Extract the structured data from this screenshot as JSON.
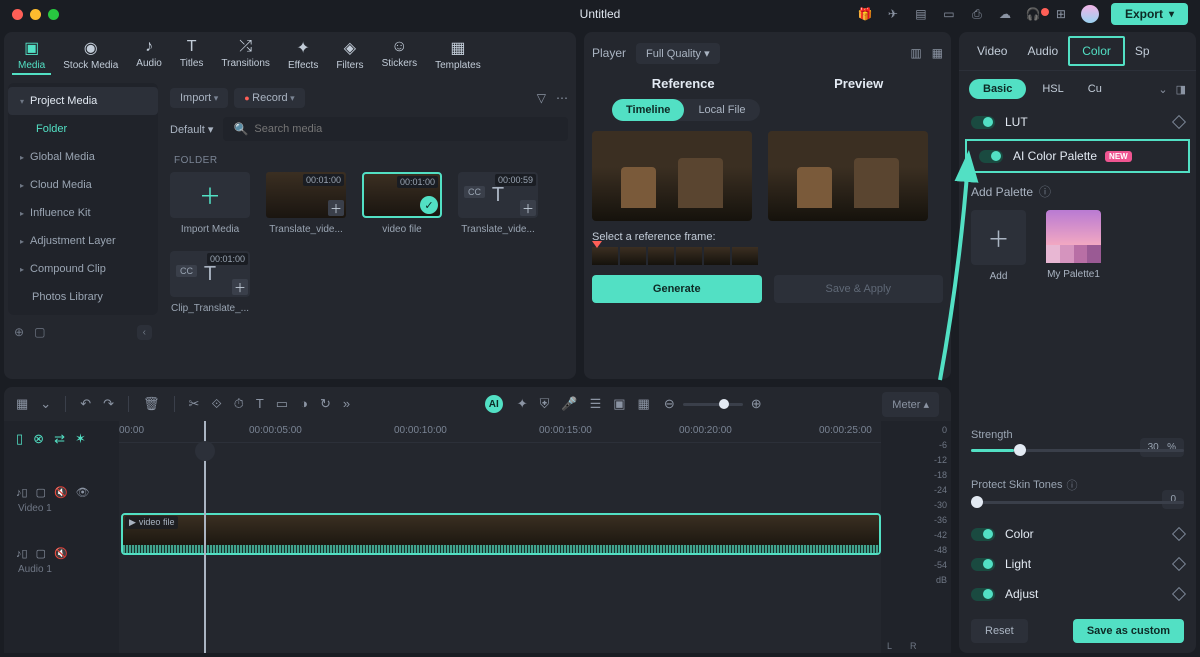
{
  "window": {
    "title": "Untitled"
  },
  "titlebar": {
    "export": "Export"
  },
  "mediaTabs": [
    {
      "id": "media",
      "label": "Media",
      "active": true
    },
    {
      "id": "stock",
      "label": "Stock Media"
    },
    {
      "id": "audio",
      "label": "Audio"
    },
    {
      "id": "titles",
      "label": "Titles"
    },
    {
      "id": "transitions",
      "label": "Transitions"
    },
    {
      "id": "effects",
      "label": "Effects"
    },
    {
      "id": "filters",
      "label": "Filters"
    },
    {
      "id": "stickers",
      "label": "Stickers"
    },
    {
      "id": "templates",
      "label": "Templates"
    }
  ],
  "sidebar": {
    "items": [
      {
        "label": "Project Media",
        "expanded": true
      },
      {
        "label": "Folder",
        "accent": true
      },
      {
        "label": "Global Media"
      },
      {
        "label": "Cloud Media"
      },
      {
        "label": "Influence Kit"
      },
      {
        "label": "Adjustment Layer"
      },
      {
        "label": "Compound Clip"
      },
      {
        "label": "Photos Library"
      }
    ]
  },
  "browser": {
    "import": "Import",
    "record": "Record",
    "sort": "Default",
    "search_placeholder": "Search media",
    "folder_label": "FOLDER",
    "thumbs": [
      {
        "type": "import",
        "label": "Import Media"
      },
      {
        "type": "clip",
        "label": "Translate_vide...",
        "dur": "00:01:00"
      },
      {
        "type": "clip",
        "label": "video file",
        "dur": "00:01:00",
        "selected": true,
        "checked": true
      },
      {
        "type": "ccclip",
        "label": "Translate_vide...",
        "dur": "00:00:59"
      },
      {
        "type": "ccclip",
        "label": "Clip_Translate_...",
        "dur": "00:01:00"
      }
    ]
  },
  "preview": {
    "player": "Player",
    "quality": "Full Quality",
    "reference": "Reference",
    "preview": "Preview",
    "seg_timeline": "Timeline",
    "seg_local": "Local File",
    "select_ref": "Select a reference frame:",
    "generate": "Generate",
    "save_apply": "Save & Apply"
  },
  "inspector": {
    "tabs": [
      "Video",
      "Audio",
      "Color",
      "Sp"
    ],
    "active_tab": "Color",
    "sub_active": "Basic",
    "sub_tabs": [
      "Basic",
      "HSL",
      "Cu"
    ],
    "lut": "LUT",
    "ai_palette": "AI Color Palette",
    "new_badge": "NEW",
    "add_palette": "Add Palette",
    "palettes": [
      {
        "label": "Add",
        "type": "add"
      },
      {
        "label": "My Palette1",
        "type": "palette"
      }
    ],
    "strength": {
      "label": "Strength",
      "value": "30",
      "unit": "%"
    },
    "protect": {
      "label": "Protect Skin Tones",
      "value": "0"
    },
    "sections": [
      "Color",
      "Light",
      "Adjust"
    ],
    "reset": "Reset",
    "save_custom": "Save as custom"
  },
  "timeline": {
    "meter": "Meter",
    "timestamps": [
      "00:00",
      "00:00:05:00",
      "00:00:10:00",
      "00:00:15:00",
      "00:00:20:00",
      "00:00:25:00"
    ],
    "meter_scale": [
      "0",
      "-6",
      "-12",
      "-18",
      "-24",
      "-30",
      "-36",
      "-42",
      "-48",
      "-54",
      "dB"
    ],
    "meter_labels": [
      "L",
      "R"
    ],
    "tracks": [
      {
        "name": "Video 1",
        "icon": "video"
      },
      {
        "name": "Audio 1",
        "icon": "audio"
      }
    ],
    "clip": {
      "name": "video file"
    }
  }
}
